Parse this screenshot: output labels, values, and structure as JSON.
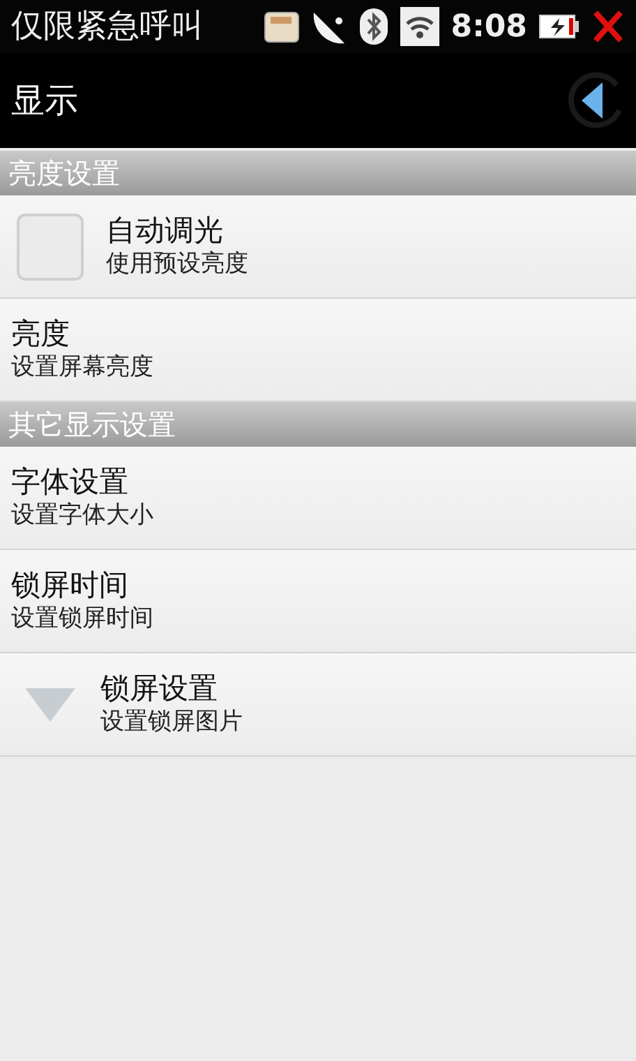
{
  "status_bar": {
    "carrier": "仅限紧急呼叫",
    "time": "8:08"
  },
  "header": {
    "title": "显示"
  },
  "items": [
    {
      "kind": "section",
      "title": "亮度设置"
    },
    {
      "kind": "checkbox",
      "title": "自动调光",
      "summary": "使用预设亮度",
      "checked": false
    },
    {
      "kind": "plain",
      "title": "亮度",
      "summary": "设置屏幕亮度"
    },
    {
      "kind": "section",
      "title": "其它显示设置"
    },
    {
      "kind": "plain",
      "title": "字体设置",
      "summary": "设置字体大小"
    },
    {
      "kind": "plain",
      "title": "锁屏时间",
      "summary": "设置锁屏时间"
    },
    {
      "kind": "expand",
      "title": "锁屏设置",
      "summary": "设置锁屏图片"
    }
  ]
}
